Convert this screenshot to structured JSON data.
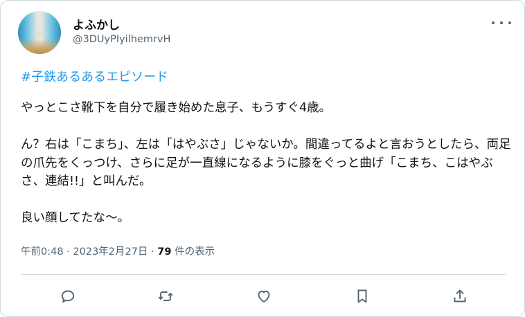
{
  "user": {
    "display_name": "よふかし",
    "handle": "@3DUyPIyilhemrvH"
  },
  "post": {
    "hashtag": "#子鉄あるあるエピソード",
    "lines": [
      "やっとこさ靴下を自分で履き始めた息子、もうすぐ4歳。",
      "",
      "ん？右は「こまち」、左は「はやぶさ」じゃないか。間違ってるよと言おうとしたら、両足の爪先をくっつけ、さらに足が一直線になるように膝をぐっと曲げ「こまち、こはやぶさ、連結!!」と叫んだ。",
      "",
      "良い顔してたな〜。"
    ],
    "timestamp": "午前0:48 · 2023年2月27日 · ",
    "view_count": "79",
    "view_label": " 件の表示"
  },
  "icons": {
    "more": "more-dots-icon",
    "reply": "reply-icon",
    "repost": "repost-icon",
    "like": "like-icon",
    "bookmark": "bookmark-icon",
    "share": "share-icon"
  },
  "colors": {
    "accent": "#1d9bf0",
    "text": "#0f1419",
    "secondary": "#536471",
    "border": "#cfd9de"
  }
}
